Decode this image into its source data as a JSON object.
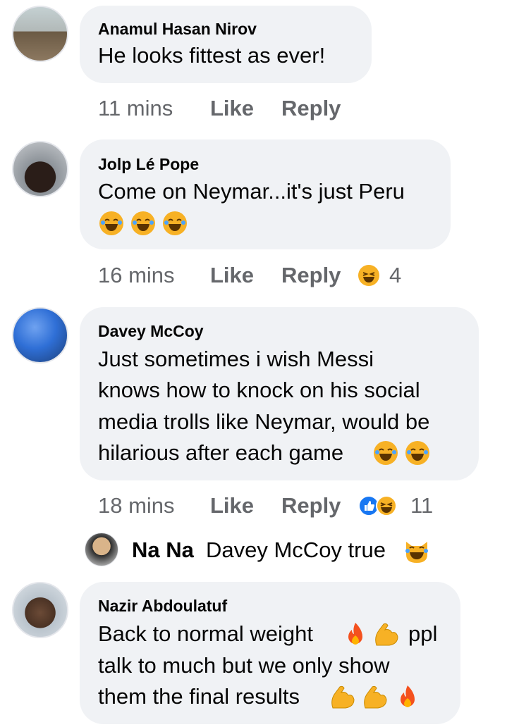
{
  "comments": [
    {
      "author": "Anamul Hasan Nirov",
      "lines": [
        "He looks fittest as ever!"
      ],
      "time": "11 mins",
      "like": "Like",
      "reply": "Reply",
      "avatar_colors": [
        "#b9c7c9",
        "#6b5a44"
      ]
    },
    {
      "author": "Jolp Lé Pope",
      "lines": [
        "Come on Neymar...it's just Peru"
      ],
      "emoji_row": [
        "laughing-tears",
        "laughing-tears",
        "laughing-tears"
      ],
      "time": "16 mins",
      "like": "Like",
      "reply": "Reply",
      "reaction_count": "4",
      "reactions": [
        "haha"
      ],
      "avatar_colors": [
        "#9aa0a6",
        "#2a1d18"
      ]
    },
    {
      "author": "Davey McCoy",
      "lines": [
        "Just sometimes i wish Messi",
        "knows how to knock on his social",
        "media trolls like Neymar, would be",
        "hilarious after each game"
      ],
      "time": "18 mins",
      "like": "Like",
      "reply": "Reply",
      "reaction_count": "11",
      "reactions": [
        "like",
        "haha"
      ],
      "avatar_colors": [
        "#2f6fd6",
        "#1d3f78"
      ]
    },
    {
      "author": "Nazir Abdoulatuf",
      "lines": [
        "Back to normal weight",
        "talk to much but we only show",
        "them the final results"
      ],
      "line1_tail": "ppl",
      "avatar_colors": [
        "#c9d3dc",
        "#4a3224"
      ]
    }
  ],
  "reply_preview": {
    "author": "Na Na",
    "text": "Davey McCoy true"
  },
  "colors": {
    "bubble": "#f0f2f5",
    "meta_text": "#65676b",
    "emoji": "#f7b125",
    "like_blue": "#1877f2",
    "fire": "#f4511e"
  }
}
